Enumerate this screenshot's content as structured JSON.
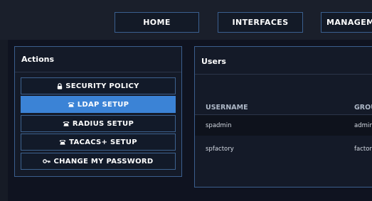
{
  "nav": {
    "home": "HOME",
    "interfaces": "INTERFACES",
    "management": "MANAGEMENT"
  },
  "actions": {
    "title": "Actions",
    "items": [
      {
        "label": "SECURITY POLICY",
        "icon": "lock-icon",
        "active": false
      },
      {
        "label": "LDAP SETUP",
        "icon": "phone-icon",
        "active": true
      },
      {
        "label": "RADIUS SETUP",
        "icon": "phone-icon",
        "active": false
      },
      {
        "label": "TACACS+ SETUP",
        "icon": "phone-icon",
        "active": false
      },
      {
        "label": "CHANGE MY PASSWORD",
        "icon": "key-icon",
        "active": false
      }
    ]
  },
  "users": {
    "title": "Users",
    "columns": [
      "USERNAME",
      "GROUP"
    ],
    "rows": [
      {
        "username": "spadmin",
        "group": "admin"
      },
      {
        "username": "spfactory",
        "group": "factory"
      }
    ]
  },
  "colors": {
    "accent": "#3b83d6",
    "border": "#3b5e8d",
    "background": "#0f1320"
  }
}
